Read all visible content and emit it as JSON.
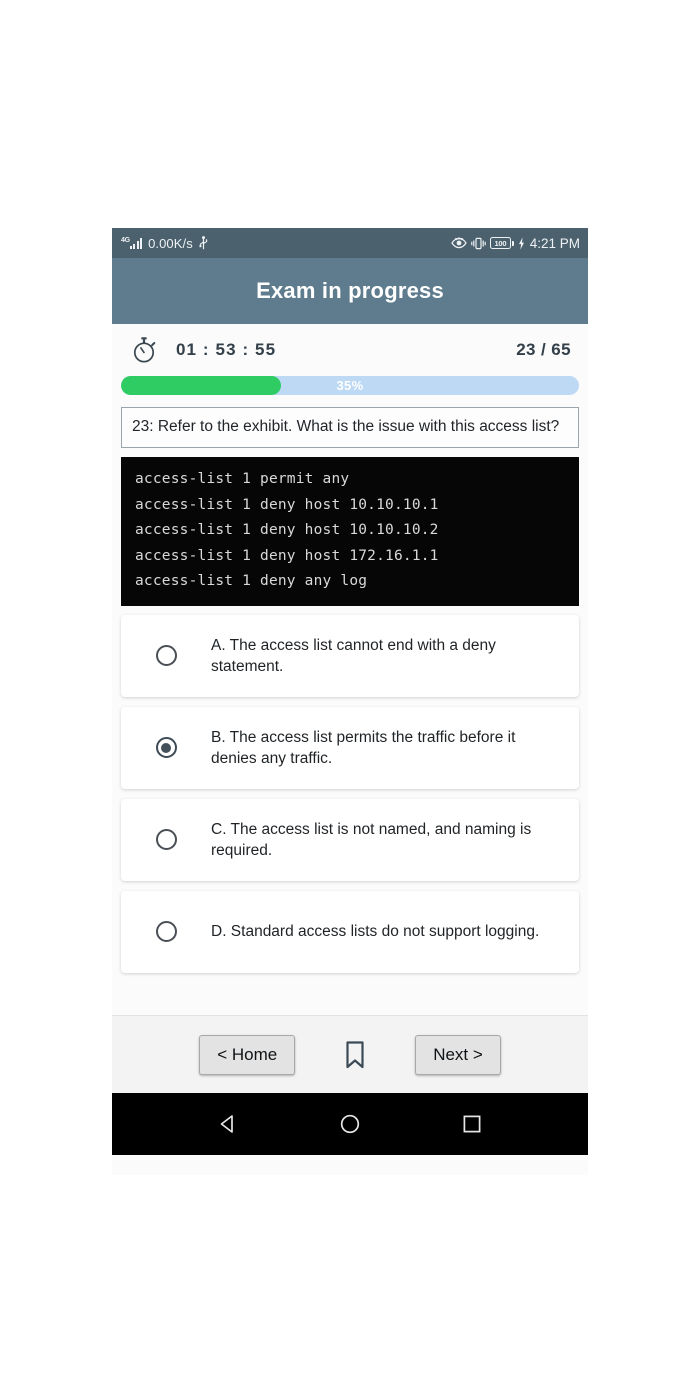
{
  "status_bar": {
    "network_generation": "4G",
    "data_speed": "0.00K/s",
    "usb_icon": "usb-icon",
    "eye_comfort_icon": "eye-icon",
    "vibrate_icon": "vibrate-icon",
    "battery_level": "100",
    "charging_icon": "charging-bolt-icon",
    "clock": "4:21 PM"
  },
  "app_bar": {
    "title": "Exam in progress"
  },
  "timer": {
    "icon": "stopwatch-icon",
    "time_remaining": "01 : 53 : 55",
    "question_counter": "23 / 65"
  },
  "progress": {
    "label": "35%",
    "percent": 35,
    "fill_color": "#2ecc63",
    "track_color": "#bed9f4"
  },
  "question": {
    "text": "23: Refer to the exhibit. What is the issue with this access list?",
    "exhibit_code": "access-list 1 permit any\naccess-list 1 deny host 10.10.10.1\naccess-list 1 deny host 10.10.10.2\naccess-list 1 deny host 172.16.1.1\naccess-list 1 deny any log"
  },
  "options": [
    {
      "id": "A",
      "text": "A. The access list cannot end with a deny statement.",
      "selected": false
    },
    {
      "id": "B",
      "text": "B. The access list permits the traffic before it denies any traffic.",
      "selected": true
    },
    {
      "id": "C",
      "text": "C. The access list is not named, and naming is required.",
      "selected": false
    },
    {
      "id": "D",
      "text": "D. Standard access lists do not support logging.",
      "selected": false
    }
  ],
  "action_bar": {
    "home_label": "< Home",
    "bookmark_icon": "bookmark-icon",
    "next_label": "Next >"
  },
  "android_nav": {
    "back_icon": "back-triangle-icon",
    "home_icon": "home-circle-icon",
    "recents_icon": "recents-square-icon"
  }
}
